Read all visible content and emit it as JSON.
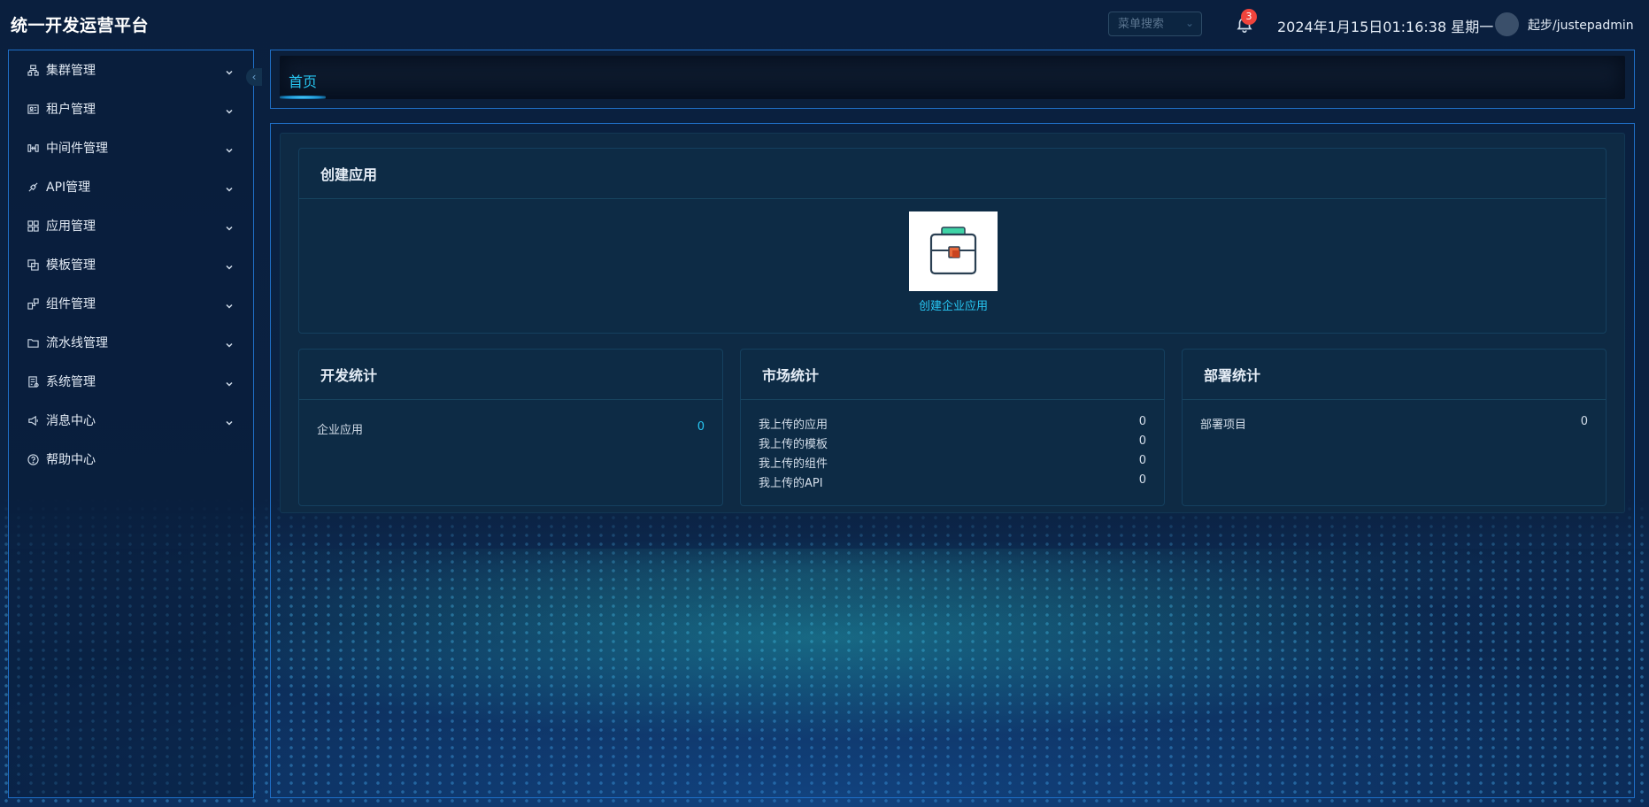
{
  "app_title": "统一开发运营平台",
  "header": {
    "menu_search_placeholder": "菜单搜索",
    "notification_count": "3",
    "datetime": "2024年1月15日01:16:38 星期一",
    "username": "起步/justepadmin"
  },
  "sidebar": {
    "items": [
      {
        "label": "集群管理",
        "icon": "cluster-icon",
        "expandable": true
      },
      {
        "label": "租户管理",
        "icon": "tenant-icon",
        "expandable": true
      },
      {
        "label": "中间件管理",
        "icon": "middleware-icon",
        "expandable": true
      },
      {
        "label": "API管理",
        "icon": "api-icon",
        "expandable": true
      },
      {
        "label": "应用管理",
        "icon": "apps-grid-icon",
        "expandable": true
      },
      {
        "label": "模板管理",
        "icon": "template-icon",
        "expandable": true
      },
      {
        "label": "组件管理",
        "icon": "component-icon",
        "expandable": true
      },
      {
        "label": "流水线管理",
        "icon": "folder-icon",
        "expandable": true
      },
      {
        "label": "系统管理",
        "icon": "system-icon",
        "expandable": true
      },
      {
        "label": "消息中心",
        "icon": "megaphone-icon",
        "expandable": true
      },
      {
        "label": "帮助中心",
        "icon": "help-icon",
        "expandable": false
      }
    ]
  },
  "tabs": [
    {
      "label": "首页",
      "active": true
    }
  ],
  "create_app": {
    "title": "创建应用",
    "item_label": "创建企业应用",
    "icon": "briefcase-icon"
  },
  "dev_stats": {
    "title": "开发统计",
    "rows": [
      {
        "label": "企业应用",
        "value": "0"
      }
    ]
  },
  "market_stats": {
    "title": "市场统计",
    "rows": [
      {
        "label": "我上传的应用",
        "value": "0"
      },
      {
        "label": "我上传的模板",
        "value": "0"
      },
      {
        "label": "我上传的组件",
        "value": "0"
      },
      {
        "label": "我上传的API",
        "value": "0"
      }
    ]
  },
  "deploy_stats": {
    "title": "部署统计",
    "rows": [
      {
        "label": "部署项目",
        "value": "0"
      }
    ]
  },
  "colors": {
    "accent": "#27c6f2",
    "border": "#1f6fc7",
    "badge": "#f0443c",
    "card_bg": "#0d2b45"
  }
}
